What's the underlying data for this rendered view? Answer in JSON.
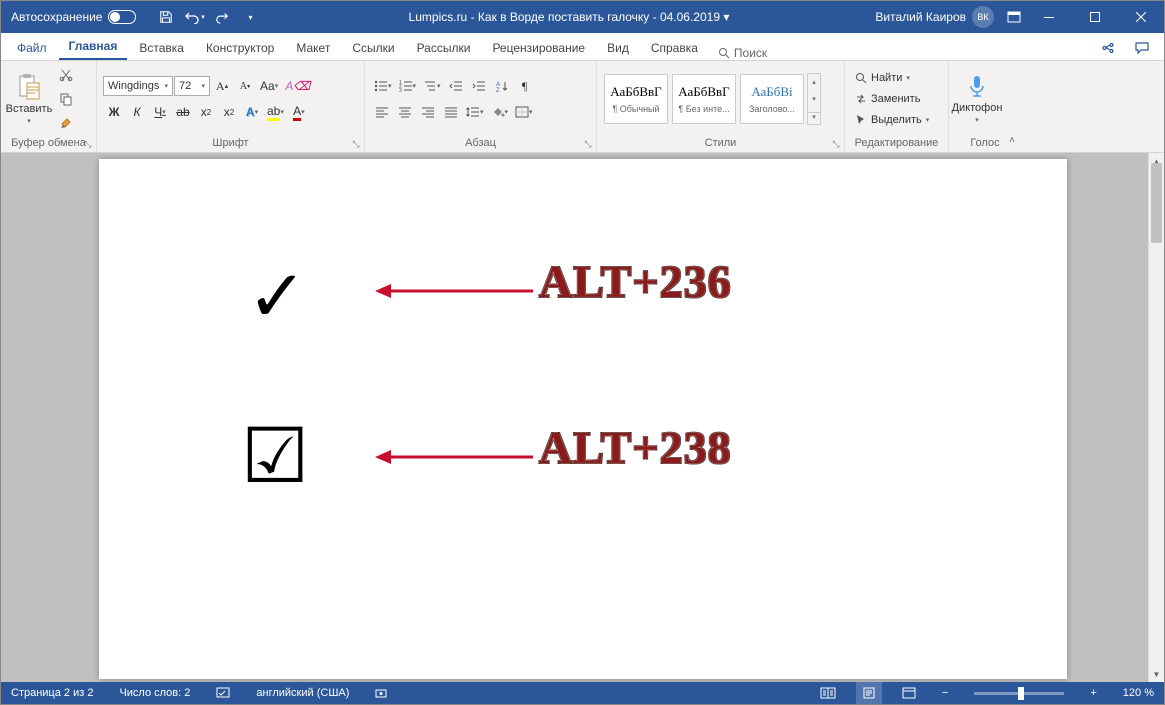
{
  "titlebar": {
    "autosave_label": "Автосохранение",
    "doc_title": "Lumpics.ru - Как в Ворде поставить галочку - 04.06.2019 ▾",
    "user_name": "Виталий Каиров",
    "user_initials": "ВК"
  },
  "tabs": {
    "file": "Файл",
    "home": "Главная",
    "insert": "Вставка",
    "design": "Конструктор",
    "layout": "Макет",
    "references": "Ссылки",
    "mailings": "Рассылки",
    "review": "Рецензирование",
    "view": "Вид",
    "help": "Справка",
    "search": "Поиск"
  },
  "ribbon": {
    "clipboard": {
      "paste": "Вставить",
      "label": "Буфер обмена"
    },
    "font": {
      "name": "Wingdings",
      "size": "72",
      "bold": "Ж",
      "italic": "К",
      "underline": "Ч",
      "strike": "ab",
      "label": "Шрифт"
    },
    "paragraph": {
      "label": "Абзац"
    },
    "styles": {
      "preview": "АаБбВвГ",
      "preview_heading": "АаБбВі",
      "normal": "¶ Обычный",
      "nospacing": "¶ Без инте...",
      "heading1": "Заголово...",
      "label": "Стили"
    },
    "editing": {
      "find": "Найти",
      "replace": "Заменить",
      "select": "Выделить",
      "label": "Редактирование"
    },
    "voice": {
      "dictate": "Диктофон",
      "label": "Голос"
    }
  },
  "doc": {
    "annot1": "ALT+236",
    "annot2": "ALT+238"
  },
  "statusbar": {
    "page": "Страница 2 из 2",
    "words": "Число слов: 2",
    "lang": "английский (США)",
    "zoom": "120 %"
  }
}
